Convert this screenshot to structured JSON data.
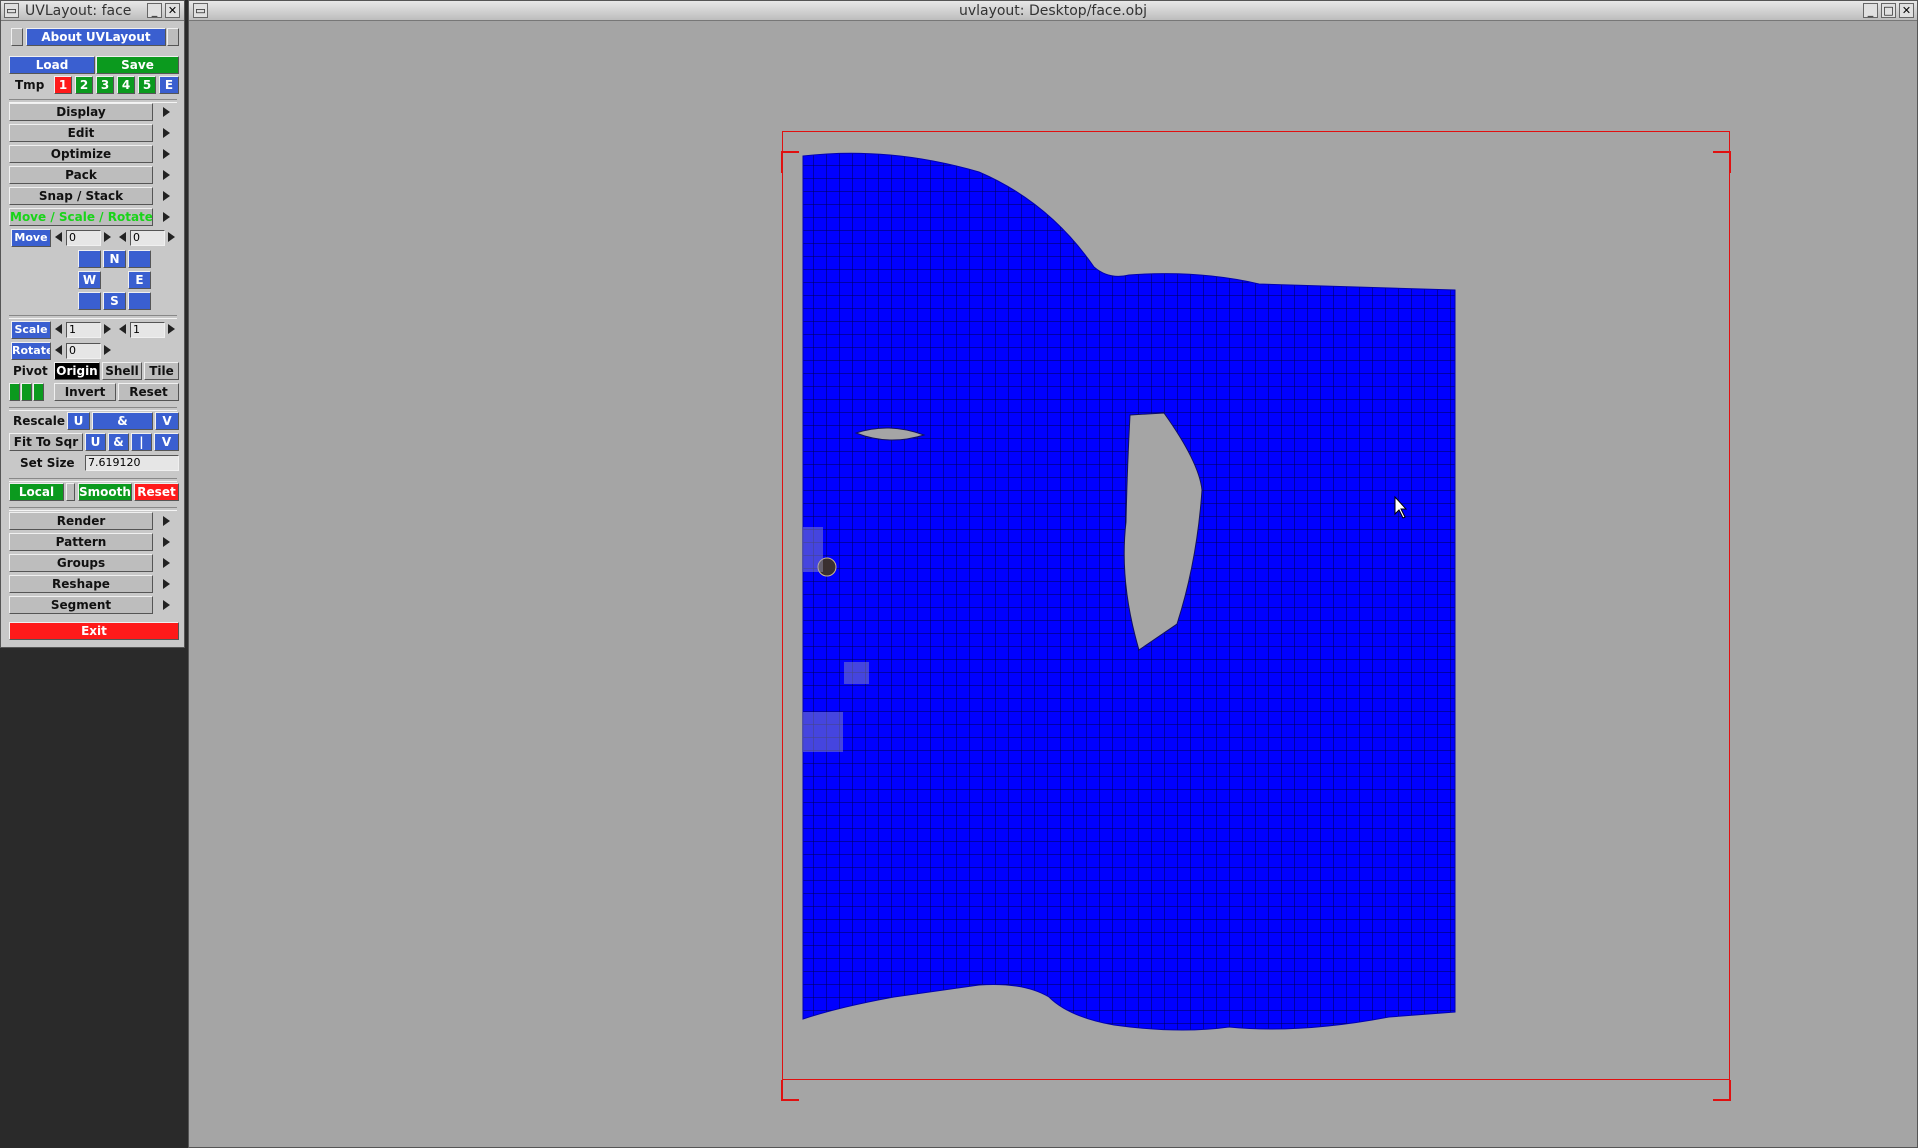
{
  "palette": {
    "title": "UVLayout: face",
    "about": "About UVLayout",
    "load": "Load",
    "save": "Save",
    "tmp": {
      "label": "Tmp",
      "slots": [
        "1",
        "2",
        "3",
        "4",
        "5",
        "E"
      ]
    },
    "menus_top": [
      "Display",
      "Edit",
      "Optimize",
      "Pack",
      "Snap / Stack",
      "Move / Scale / Rotate"
    ],
    "move": {
      "label": "Move",
      "u": "0",
      "v": "0"
    },
    "compass": {
      "n": "N",
      "w": "W",
      "e": "E",
      "s": "S"
    },
    "scale": {
      "label": "Scale",
      "u": "1",
      "v": "1"
    },
    "rotate": {
      "label": "Rotate",
      "value": "0"
    },
    "pivot": {
      "label": "Pivot",
      "origin": "Origin",
      "shell": "Shell",
      "tile": "Tile"
    },
    "invert": "Invert",
    "reset": "Reset",
    "rescale": {
      "label": "Rescale",
      "u": "U",
      "amp": "&",
      "v": "V"
    },
    "fit": {
      "label": "Fit To Sqr",
      "u": "U",
      "amp": "&",
      "bar": "|",
      "v": "V"
    },
    "set_size": {
      "label": "Set Size",
      "value": "7.619120"
    },
    "local": "Local",
    "smooth": "Smooth",
    "reset_red": "Reset",
    "menus_bottom": [
      "Render",
      "Pattern",
      "Groups",
      "Reshape",
      "Segment"
    ],
    "exit": "Exit"
  },
  "viewer": {
    "title": "uvlayout: Desktop/face.obj"
  },
  "colors": {
    "mesh_fill": "#0000ff",
    "mesh_lines": "#000060",
    "uv_box": "#e01010",
    "background": "#a5a5a5"
  }
}
